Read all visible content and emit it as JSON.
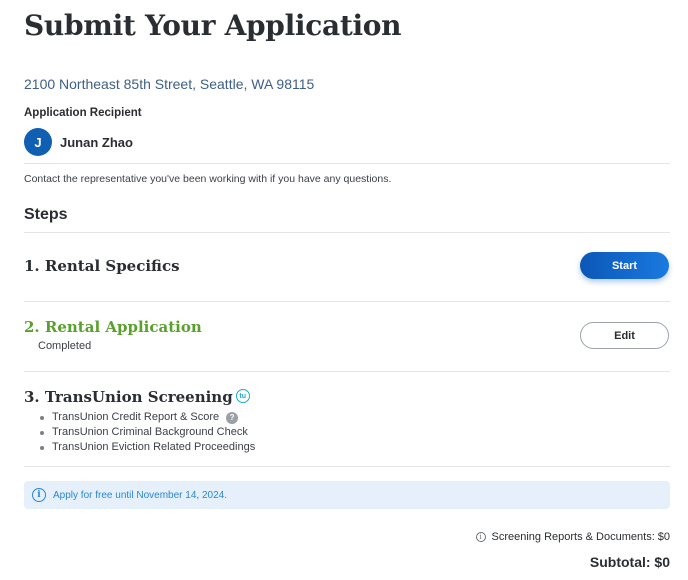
{
  "page": {
    "title": "Submit Your Application"
  },
  "property": {
    "address": "2100 Northeast 85th Street, Seattle, WA 98115"
  },
  "recipient": {
    "label": "Application Recipient",
    "initial": "J",
    "name": "Junan Zhao"
  },
  "contact_note": "Contact the representative you've been working with if you have any questions.",
  "steps": {
    "heading": "Steps",
    "items": [
      {
        "title": "1. Rental Specifics",
        "button": "Start"
      },
      {
        "title": "2. Rental Application",
        "status": "Completed",
        "button": "Edit"
      },
      {
        "title": "3. TransUnion Screening",
        "badge": "tu",
        "bullets": [
          "TransUnion Credit Report & Score",
          "TransUnion Criminal Background Check",
          "TransUnion Eviction Related Proceedings"
        ]
      }
    ]
  },
  "info_banner": {
    "text": "Apply for free until November 14, 2024."
  },
  "fees": {
    "screening_label": "Screening Reports & Documents:",
    "screening_value": "$0",
    "subtotal_label": "Subtotal:",
    "subtotal_value": "$0"
  },
  "colors": {
    "primary": "#0b57b6",
    "completed": "#5aa02c",
    "info": "#2a86d6",
    "address": "#3e5f86"
  }
}
